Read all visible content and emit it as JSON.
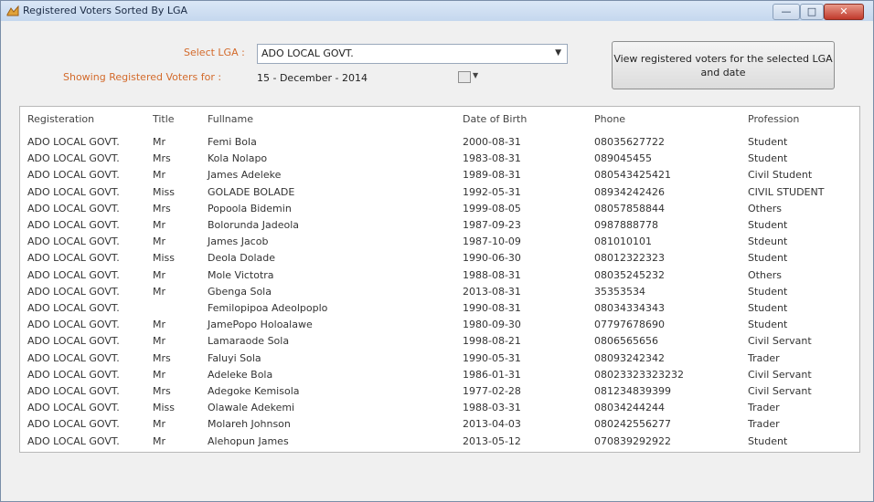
{
  "window": {
    "title": "Registered Voters Sorted By LGA"
  },
  "filters": {
    "lga_label": "Select LGA :",
    "lga_value": "ADO LOCAL GOVT.",
    "date_label": "Showing Registered Voters for :",
    "date_value": "15 - December - 2014"
  },
  "actions": {
    "view_button": "View registered voters for the selected LGA and date"
  },
  "table": {
    "columns": [
      "Registeration",
      "Title",
      "Fullname",
      "Date of Birth",
      "Phone",
      "Profession"
    ],
    "rows": [
      [
        "ADO LOCAL GOVT.",
        "Mr",
        "Femi Bola",
        "2000-08-31",
        "08035627722",
        "Student"
      ],
      [
        "ADO LOCAL GOVT.",
        "Mrs",
        "Kola Nolapo",
        "1983-08-31",
        "089045455",
        "Student"
      ],
      [
        "ADO LOCAL GOVT.",
        "Mr",
        "James Adeleke",
        "1989-08-31",
        "080543425421",
        "Civil Student"
      ],
      [
        "ADO LOCAL GOVT.",
        "Miss",
        "GOLADE BOLADE",
        "1992-05-31",
        "08934242426",
        "CIVIL STUDENT"
      ],
      [
        "ADO LOCAL GOVT.",
        "Mrs",
        "Popoola Bidemin",
        "1999-08-05",
        "08057858844",
        "Others"
      ],
      [
        "ADO LOCAL GOVT.",
        "Mr",
        "Bolorunda Jadeola",
        "1987-09-23",
        "0987888778",
        "Student"
      ],
      [
        "ADO LOCAL GOVT.",
        "Mr",
        "James Jacob",
        "1987-10-09",
        "081010101",
        "Stdeunt"
      ],
      [
        "ADO LOCAL GOVT.",
        "Miss",
        "Deola Dolade",
        "1990-06-30",
        "08012322323",
        "Student"
      ],
      [
        "ADO LOCAL GOVT.",
        "Mr",
        "Mole Victotra",
        "1988-08-31",
        "08035245232",
        "Others"
      ],
      [
        "ADO LOCAL GOVT.",
        "Mr",
        "Gbenga Sola",
        "2013-08-31",
        "35353534",
        "Student"
      ],
      [
        "ADO LOCAL GOVT.",
        "",
        "Femilopipoa Adeolpoplo",
        "1990-08-31",
        "08034334343",
        "Student"
      ],
      [
        "ADO LOCAL GOVT.",
        "Mr",
        "JamePopo Holoalawe",
        "1980-09-30",
        "07797678690",
        "Student"
      ],
      [
        "ADO LOCAL GOVT.",
        "Mr",
        "Lamaraode Sola",
        "1998-08-21",
        "0806565656",
        "Civil Servant"
      ],
      [
        "ADO LOCAL GOVT.",
        "Mrs",
        "Faluyi Sola",
        "1990-05-31",
        "08093242342",
        "Trader"
      ],
      [
        "ADO LOCAL GOVT.",
        "Mr",
        "Adeleke Bola",
        "1986-01-31",
        "08023323323232",
        "Civil Servant"
      ],
      [
        "ADO LOCAL GOVT.",
        "Mrs",
        "Adegoke Kemisola",
        "1977-02-28",
        "081234839399",
        "Civil Servant"
      ],
      [
        "ADO LOCAL GOVT.",
        "Miss",
        "Olawale Adekemi",
        "1988-03-31",
        "08034244244",
        "Trader"
      ],
      [
        "ADO LOCAL GOVT.",
        "Mr",
        "Molareh Johnson",
        "2013-04-03",
        "080242556277",
        "Trader"
      ],
      [
        "ADO LOCAL GOVT.",
        "Mr",
        "Alehopun James",
        "2013-05-12",
        "070839292922",
        "Student"
      ]
    ]
  },
  "icons": {
    "app": "app-icon",
    "calendar": "calendar-icon",
    "dropdown": "chevron-down-icon"
  },
  "colors": {
    "label_orange": "#d36a2b",
    "titlebar": "#c5d7ee",
    "close": "#c0392b"
  }
}
